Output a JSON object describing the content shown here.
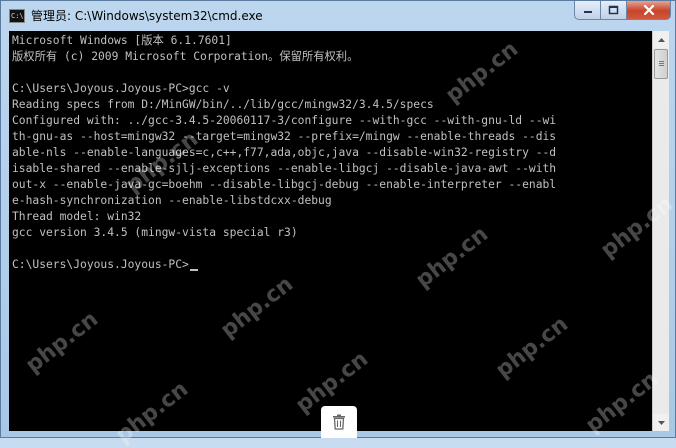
{
  "window": {
    "title": "管理员: C:\\Windows\\system32\\cmd.exe",
    "icon": "cmd-icon",
    "icon_text": "C:\\."
  },
  "console": {
    "lines": [
      "Microsoft Windows [版本 6.1.7601]",
      "版权所有 (c) 2009 Microsoft Corporation。保留所有权利。",
      "",
      "C:\\Users\\Joyous.Joyous-PC>gcc -v",
      "Reading specs from D:/MinGW/bin/../lib/gcc/mingw32/3.4.5/specs",
      "Configured with: ../gcc-3.4.5-20060117-3/configure --with-gcc --with-gnu-ld --wi",
      "th-gnu-as --host=mingw32 --target=mingw32 --prefix=/mingw --enable-threads --dis",
      "able-nls --enable-languages=c,c++,f77,ada,objc,java --disable-win32-registry --d",
      "isable-shared --enable-sjlj-exceptions --enable-libgcj --disable-java-awt --with",
      "out-x --enable-java-gc=boehm --disable-libgcj-debug --enable-interpreter --enabl",
      "e-hash-synchronization --enable-libstdcxx-debug",
      "Thread model: win32",
      "gcc version 3.4.5 (mingw-vista special r3)",
      "",
      "C:\\Users\\Joyous.Joyous-PC>"
    ]
  },
  "watermark": {
    "text": "php.cn"
  },
  "colors": {
    "console_bg": "#000000",
    "console_fg": "#c0c0c0",
    "close_button": "#c7442c"
  }
}
